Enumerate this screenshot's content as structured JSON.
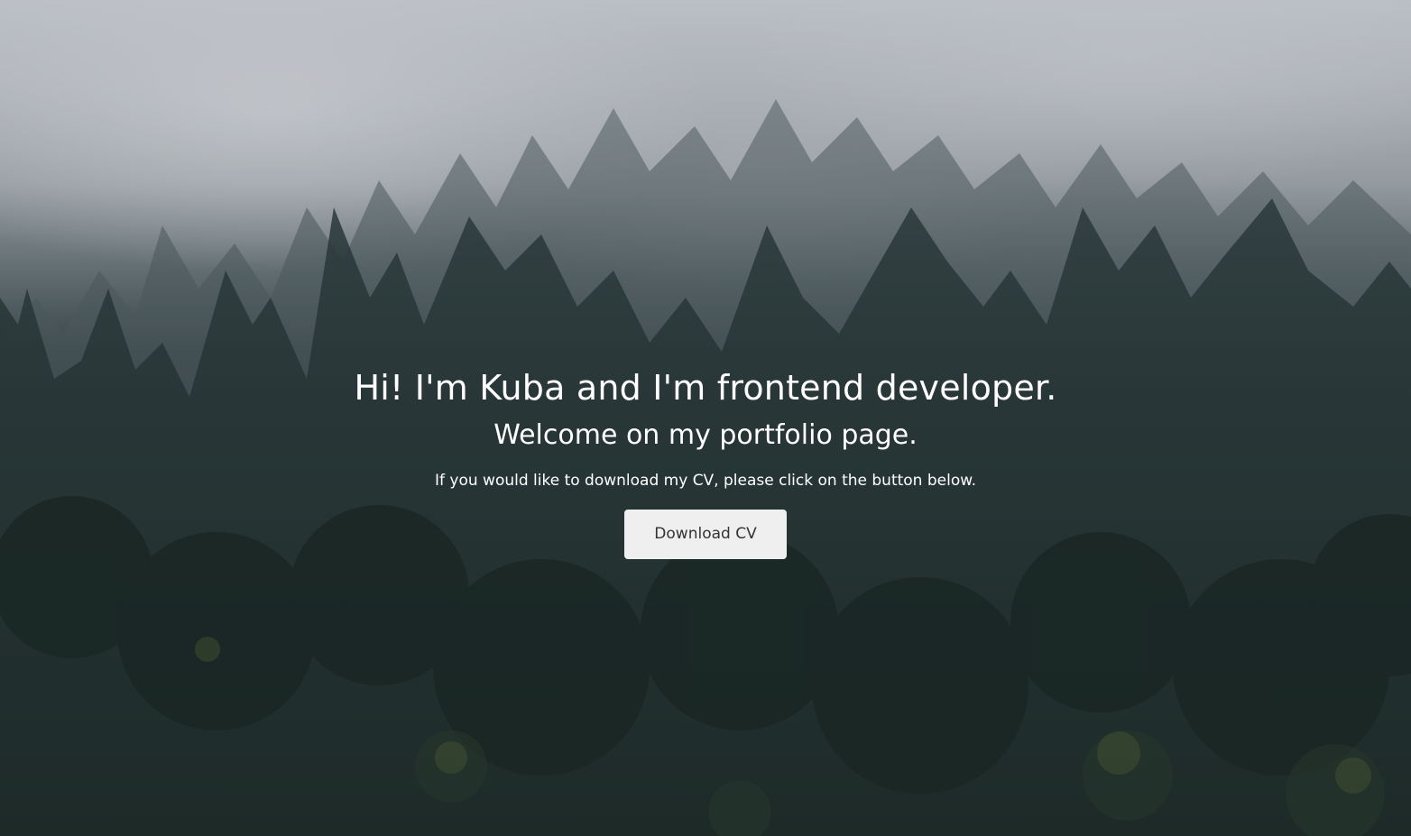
{
  "hero": {
    "title": "Hi! I'm Kuba and I'm frontend developer.",
    "subtitle": "Welcome on my portfolio page.",
    "info": "If you would like to download my CV, please click on the button below.",
    "button_label": "Download CV"
  },
  "colors": {
    "text": "#ffffff",
    "button_bg": "#efefef",
    "button_text": "#333333",
    "fog": "#d3d6de",
    "forest_dark": "#1b2624"
  }
}
